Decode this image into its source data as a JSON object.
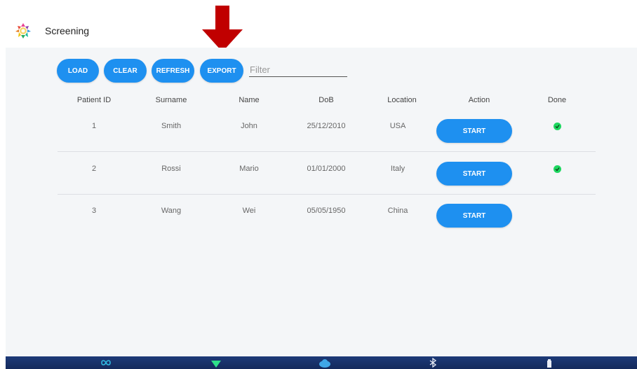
{
  "app": {
    "title": "Screening"
  },
  "toolbar": {
    "load_label": "LOAD",
    "clear_label": "CLEAR",
    "refresh_label": "REFRESH",
    "export_label": "EXPORT",
    "filter_placeholder": "Filter"
  },
  "table": {
    "headers": [
      "Patient ID",
      "Surname",
      "Name",
      "DoB",
      "Location",
      "Action",
      "Done"
    ],
    "rows": [
      {
        "id": "1",
        "surname": "Smith",
        "name": "John",
        "dob": "25/12/2010",
        "location": "USA",
        "action": "START",
        "done": true
      },
      {
        "id": "2",
        "surname": "Rossi",
        "name": "Mario",
        "dob": "01/01/2000",
        "location": "Italy",
        "action": "START",
        "done": true
      },
      {
        "id": "3",
        "surname": "Wang",
        "name": "Wei",
        "dob": "05/05/1950",
        "location": "China",
        "action": "START",
        "done": false
      }
    ]
  },
  "colors": {
    "primary": "#1e90f0",
    "done": "#1ed760",
    "arrow": "#c00000",
    "nav": "#1d3a78"
  },
  "bottom_nav": {
    "icons": [
      "infinity-icon",
      "wifi-icon",
      "cloud-icon",
      "bluetooth-icon",
      "battery-icon"
    ]
  }
}
